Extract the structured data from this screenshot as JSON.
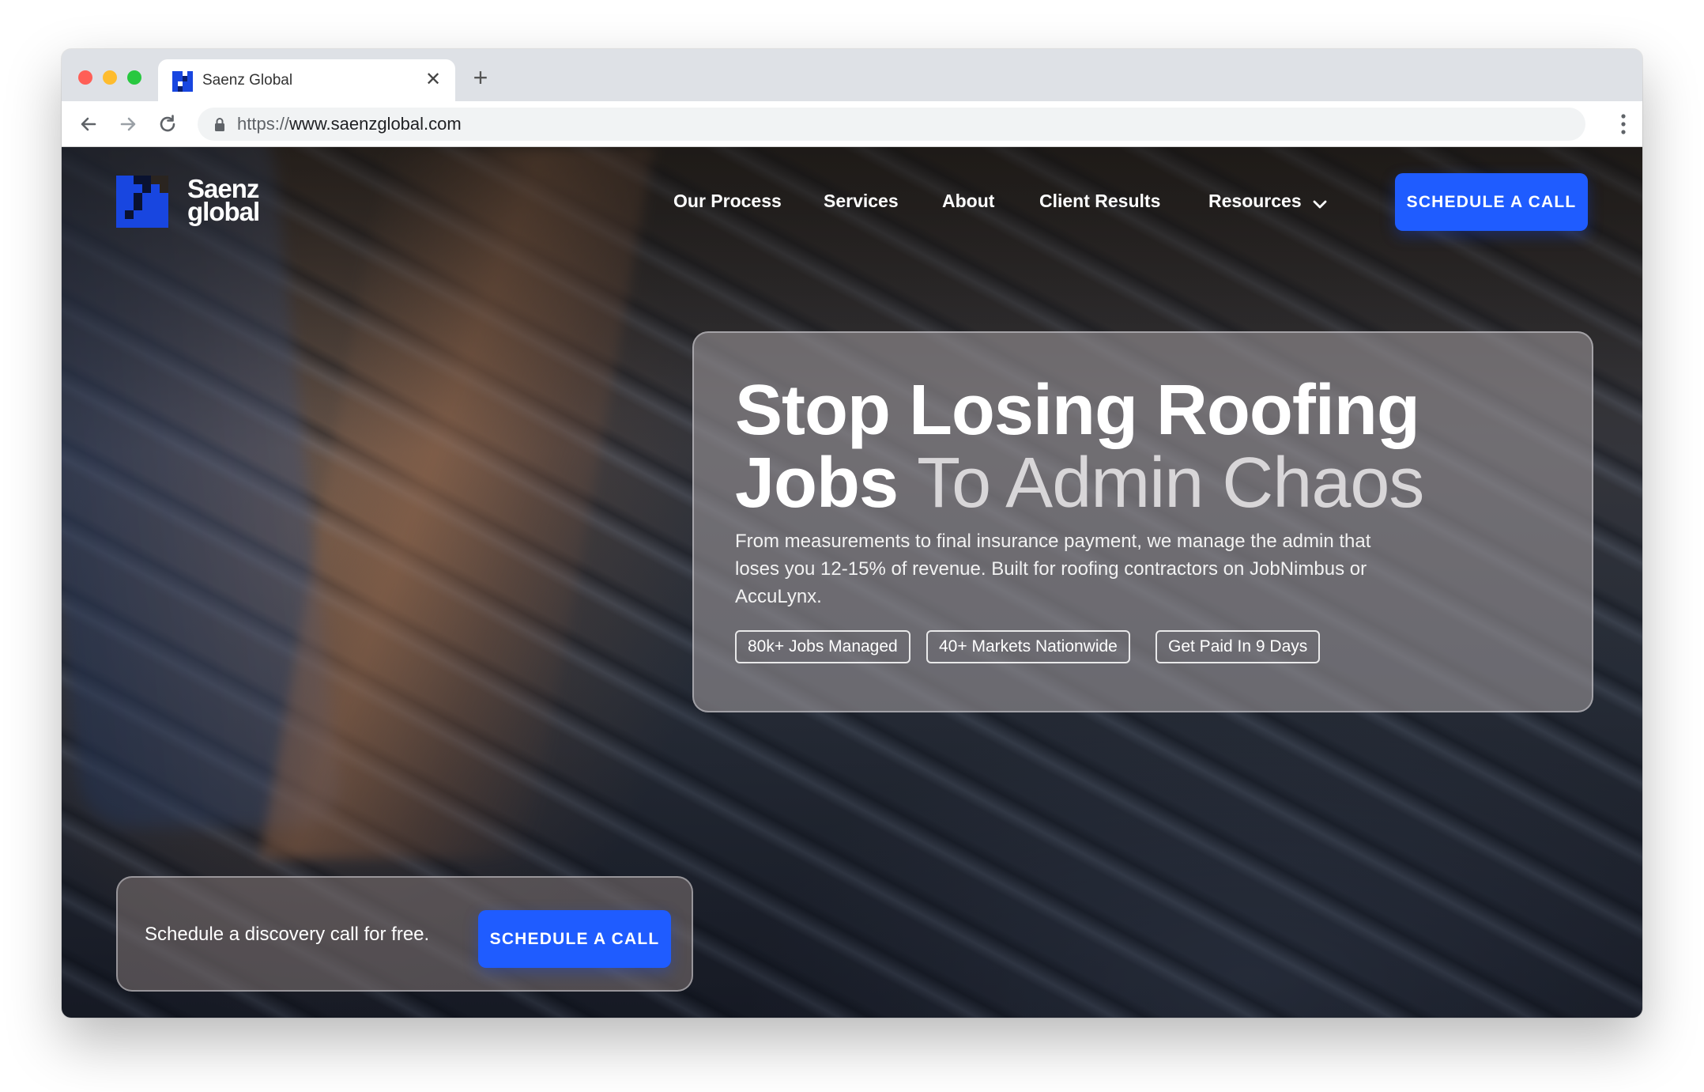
{
  "browser": {
    "tab_title": "Saenz Global",
    "tab_close": "✕",
    "new_tab": "+",
    "url_scheme": "https://",
    "url_host": "www.saenzglobal.com"
  },
  "header": {
    "logo_line1": "Saenz",
    "logo_line2": "global",
    "nav": [
      "Our Process",
      "Services",
      "About",
      "Client Results",
      "Resources"
    ],
    "cta_label": "SCHEDULE A CALL"
  },
  "hero": {
    "title_line1": "Stop Losing Roofing",
    "title_line2_strong": "Jobs",
    "title_line2_muted": "To Admin Chaos",
    "subtitle": "From measurements to final insurance payment, we manage the admin that loses you 12-15% of revenue. Built for roofing contractors on JobNimbus or AccuLynx.",
    "pills": [
      "80k+ Jobs Managed",
      "40+ Markets Nationwide",
      "Get Paid In 9 Days"
    ]
  },
  "cta_card": {
    "text": "Schedule a discovery call for free.",
    "button_label": "SCHEDULE A CALL"
  },
  "colors": {
    "accent": "#1f5cff",
    "brand_blue": "#1846e0"
  }
}
